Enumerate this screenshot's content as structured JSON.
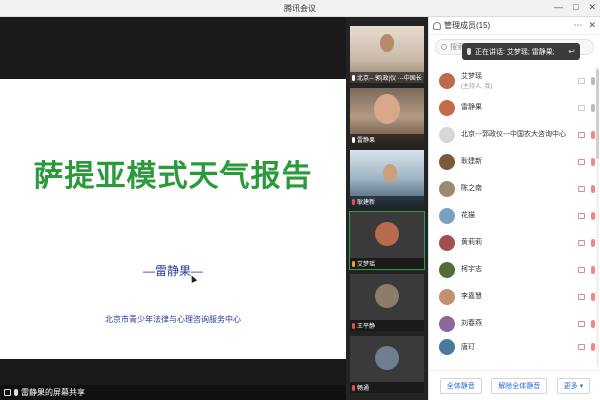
{
  "window": {
    "title": "腾讯会议",
    "controls": [
      "—",
      "□",
      "✕"
    ]
  },
  "share": {
    "slide_title": "萨提亚模式天气报告",
    "author": "—雷静果—",
    "organization": "北京市青少年法律与心理咨询服务中心",
    "status_label": "雷静果的屏幕共享"
  },
  "video_tiles": [
    {
      "label": "北京--·郭|政|仪 ·--中国长",
      "muted": false
    },
    {
      "label": "雷静果",
      "muted": false
    },
    {
      "label": "耿建新",
      "muted": true
    },
    {
      "label": "艾梦瑶",
      "muted": false
    },
    {
      "label": "王平静",
      "muted": true
    },
    {
      "label": "畅通",
      "muted": true
    }
  ],
  "panel": {
    "header": "管理成员(15)",
    "header_icons": [
      "more-icon",
      "close-icon"
    ],
    "search_placeholder": "搜索成员",
    "speaking_text": "正在讲话: 艾梦瑶; 雷静果;",
    "members": [
      {
        "name": "艾梦瑶",
        "sub": "(主持人, 我)",
        "avatar": "#b96b50",
        "mic_off": false,
        "cam_off": false
      },
      {
        "name": "雷静果",
        "sub": "",
        "avatar": "#c46a4a",
        "mic_off": false,
        "cam_off": false
      },
      {
        "name": "北京---郭政仪---中国农大咨询中心",
        "sub": "",
        "avatar": "#d7d7d7",
        "mic_off": true,
        "cam_off": true
      },
      {
        "name": "耿建新",
        "sub": "",
        "avatar": "#7a5a3a",
        "mic_off": true,
        "cam_off": true
      },
      {
        "name": "陈之南",
        "sub": "",
        "avatar": "#9a8a72",
        "mic_off": true,
        "cam_off": true
      },
      {
        "name": "花猫",
        "sub": "",
        "avatar": "#7aa0c0",
        "mic_off": true,
        "cam_off": true
      },
      {
        "name": "黄莉莉",
        "sub": "",
        "avatar": "#a05050",
        "mic_off": true,
        "cam_off": true
      },
      {
        "name": "柯宇志",
        "sub": "",
        "avatar": "#556b3a",
        "mic_off": true,
        "cam_off": true
      },
      {
        "name": "李嘉慧",
        "sub": "",
        "avatar": "#c09070",
        "mic_off": true,
        "cam_off": true
      },
      {
        "name": "刘春燕",
        "sub": "",
        "avatar": "#8a6a9a",
        "mic_off": true,
        "cam_off": true
      },
      {
        "name": "唐玎",
        "sub": "",
        "avatar": "#4a7a9a",
        "mic_off": true,
        "cam_off": true
      }
    ],
    "footer": {
      "mute_all": "全体静音",
      "unmute_all": "解除全体静音",
      "more": "更多 ▾"
    }
  }
}
